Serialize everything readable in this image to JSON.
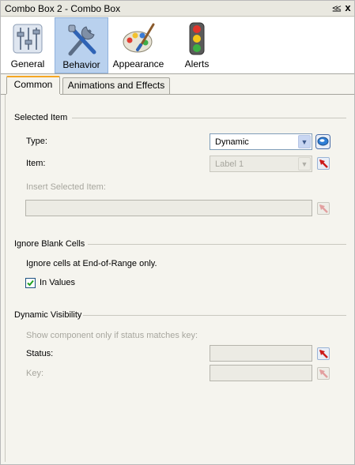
{
  "window": {
    "title": "Combo Box 2 - Combo Box",
    "pin_glyph": "⪣",
    "close_glyph": "x"
  },
  "categories": [
    {
      "label": "General",
      "icon": "sliders-icon",
      "active": false
    },
    {
      "label": "Behavior",
      "icon": "tools-icon",
      "active": true
    },
    {
      "label": "Appearance",
      "icon": "palette-icon",
      "active": false
    },
    {
      "label": "Alerts",
      "icon": "traffic-light-icon",
      "active": false
    }
  ],
  "tabs": [
    {
      "label": "Common",
      "active": true
    },
    {
      "label": "Animations and Effects",
      "active": false
    }
  ],
  "selected_item": {
    "heading": "Selected Item",
    "type_label": "Type:",
    "type_value": "Dynamic",
    "item_label": "Item:",
    "item_value": "Label 1",
    "insert_label": "Insert Selected Item:",
    "insert_value": ""
  },
  "ignore_blank": {
    "heading": "Ignore Blank Cells",
    "note": "Ignore cells at End-of-Range only.",
    "in_values_label": "In Values",
    "in_values_checked": true
  },
  "dynamic_visibility": {
    "heading": "Dynamic Visibility",
    "note": "Show component only if status matches key:",
    "status_label": "Status:",
    "status_value": "",
    "key_label": "Key:",
    "key_value": ""
  },
  "colors": {
    "active_tab_accent": "#f5a623",
    "active_category_bg": "#b9d1ee",
    "cell_picker_red": "#cc1a1a"
  }
}
